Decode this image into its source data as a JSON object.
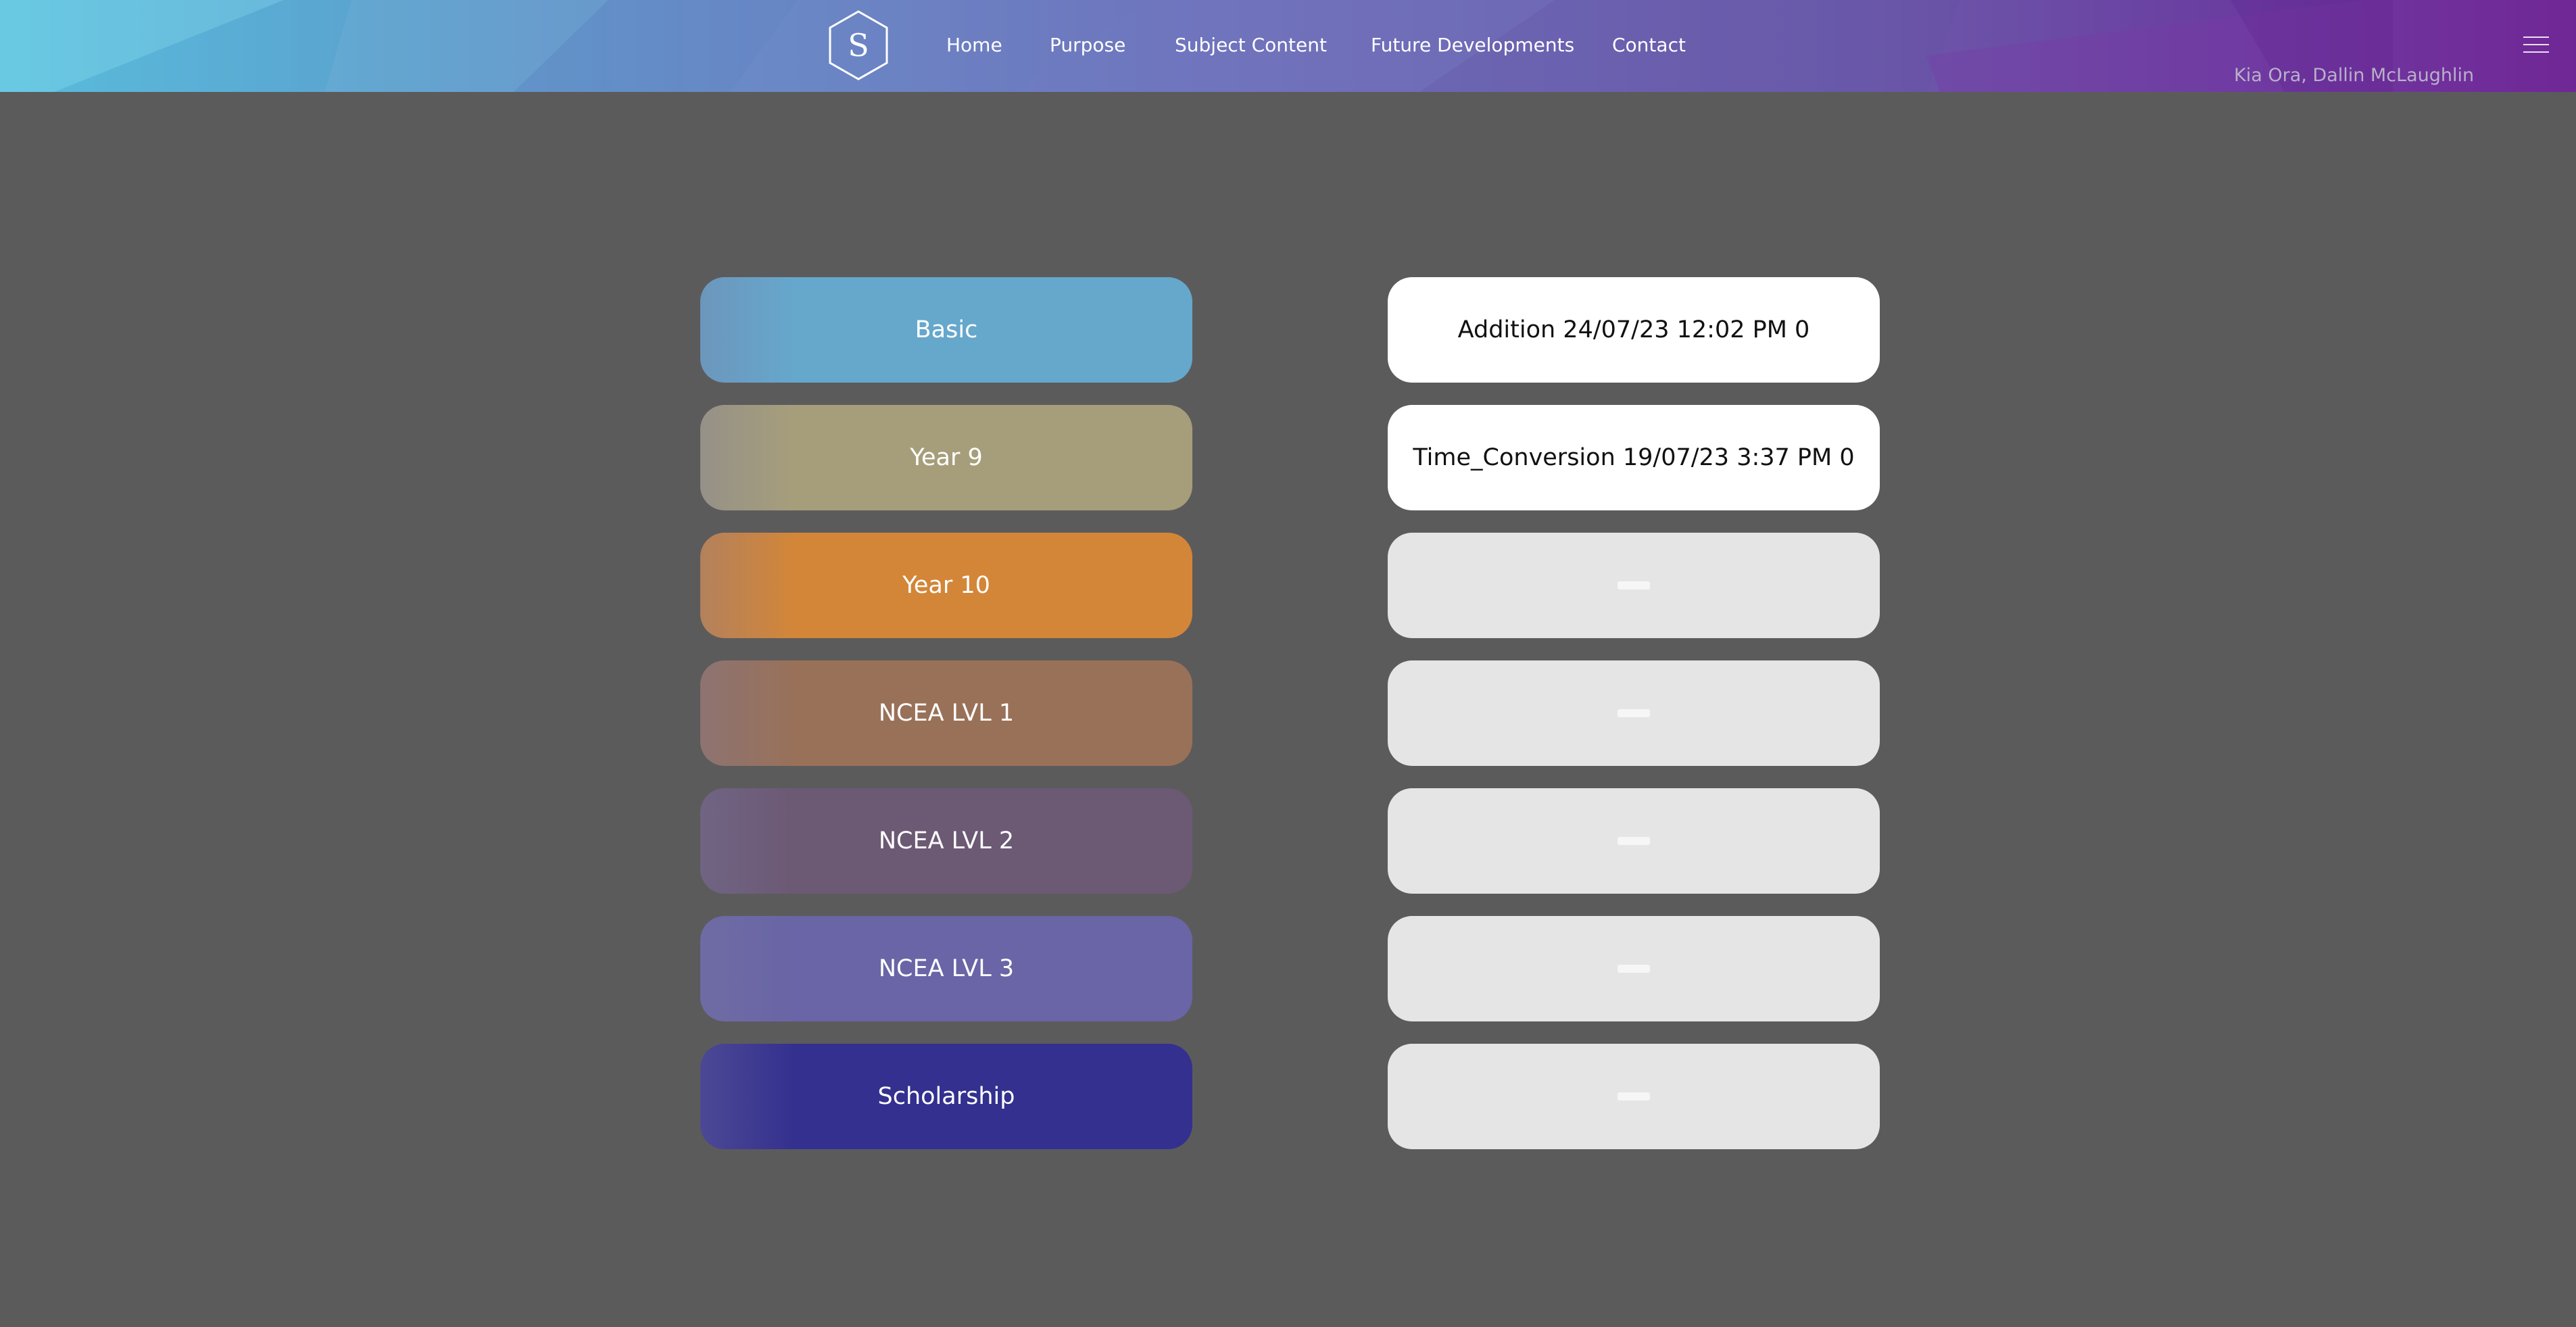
{
  "header": {
    "logo_letter": "S",
    "nav": [
      {
        "label": "Home"
      },
      {
        "label": "Purpose"
      },
      {
        "label": "Subject Content"
      },
      {
        "label": "Future Developments"
      },
      {
        "label": "Contact"
      }
    ],
    "greeting": "Kia Ora, Dallin McLaughlin",
    "menu_icon": "hamburger-menu-icon"
  },
  "levels": [
    {
      "label": "Basic",
      "color": "#66a7cc"
    },
    {
      "label": "Year 9",
      "color": "#a69e7b"
    },
    {
      "label": "Year 10",
      "color": "#d38638"
    },
    {
      "label": "NCEA LVL 1",
      "color": "#997159"
    },
    {
      "label": "NCEA LVL 2",
      "color": "#6c5974"
    },
    {
      "label": "NCEA LVL 3",
      "color": "#6965a6"
    },
    {
      "label": "Scholarship",
      "color": "#34308f"
    }
  ],
  "records": [
    {
      "text": "Addition 24/07/23 12:02 PM 0",
      "empty": false
    },
    {
      "text": "Time_Conversion 19/07/23 3:37 PM 0",
      "empty": false
    },
    {
      "text": "",
      "empty": true
    },
    {
      "text": "",
      "empty": true
    },
    {
      "text": "",
      "empty": true
    },
    {
      "text": "",
      "empty": true
    },
    {
      "text": "",
      "empty": true
    }
  ],
  "colors": {
    "page_background": "#5c5b5c",
    "record_filled": "#ffffff",
    "record_empty": "#e5e5e5"
  }
}
